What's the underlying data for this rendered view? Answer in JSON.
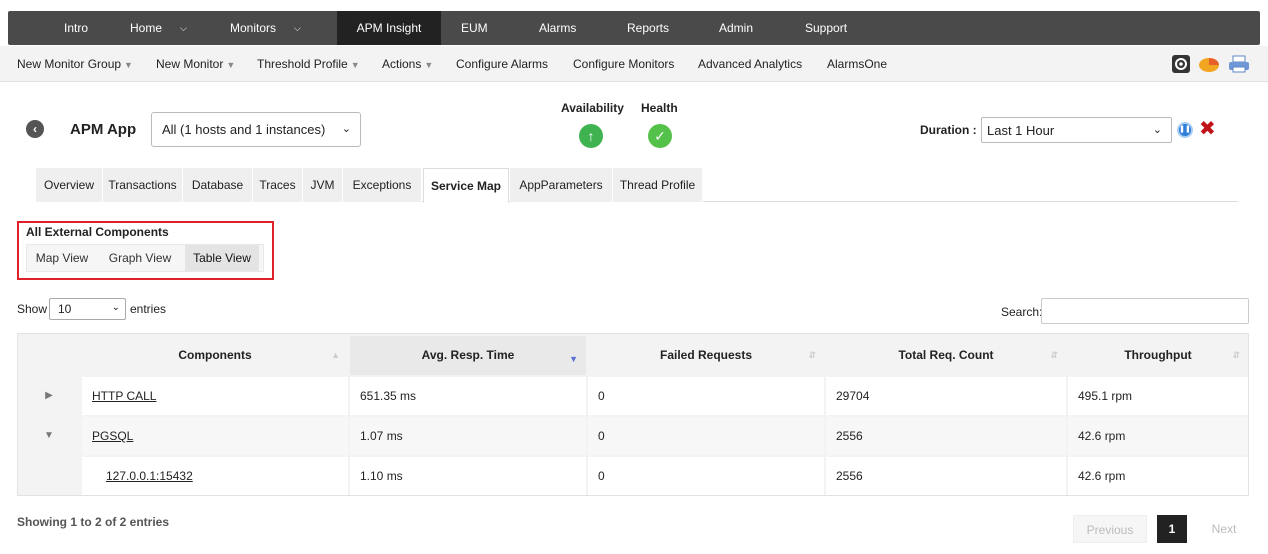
{
  "topnav": {
    "items": [
      {
        "label": "Intro",
        "caret": false
      },
      {
        "label": "Home",
        "caret": true
      },
      {
        "label": "Monitors",
        "caret": true
      },
      {
        "label": "APM Insight",
        "caret": false,
        "active": true
      },
      {
        "label": "EUM",
        "caret": false
      },
      {
        "label": "Alarms",
        "caret": false
      },
      {
        "label": "Reports",
        "caret": false
      },
      {
        "label": "Admin",
        "caret": false
      },
      {
        "label": "Support",
        "caret": false
      }
    ]
  },
  "subnav": {
    "new_monitor_group": "New Monitor Group",
    "new_monitor": "New Monitor",
    "threshold_profile": "Threshold Profile",
    "actions": "Actions",
    "configure_alarms": "Configure Alarms",
    "configure_monitors": "Configure Monitors",
    "advanced_analytics": "Advanced Analytics",
    "alarms_one": "AlarmsOne"
  },
  "header": {
    "app_title": "APM App",
    "host_select": "All (1 hosts and 1 instances)",
    "availability_label": "Availability",
    "health_label": "Health",
    "duration_label": "Duration :",
    "duration_value": "Last 1 Hour"
  },
  "tabs": [
    "Overview",
    "Transactions",
    "Database",
    "Traces",
    "JVM",
    "Exceptions",
    "Service Map",
    "AppParameters",
    "Thread Profile"
  ],
  "external": {
    "title": "All External Components",
    "views": [
      "Map View",
      "Graph View",
      "Table View"
    ]
  },
  "table_controls": {
    "show": "Show",
    "entries_value": "10",
    "entries": "entries",
    "search": "Search:"
  },
  "table": {
    "columns": [
      "Components",
      "Avg. Resp. Time",
      "Failed Requests",
      "Total Req. Count",
      "Throughput"
    ],
    "rows": [
      {
        "toggle": "▶",
        "component": "HTTP CALL",
        "avg": "651.35 ms",
        "failed": "0",
        "total": "29704",
        "throughput": "495.1 rpm"
      },
      {
        "toggle": "▼",
        "component": "PGSQL",
        "avg": "1.07 ms",
        "failed": "0",
        "total": "2556",
        "throughput": "42.6 rpm"
      },
      {
        "toggle": "",
        "component": "127.0.0.1:15432",
        "avg": "1.10 ms",
        "failed": "0",
        "total": "2556",
        "throughput": "42.6 rpm"
      }
    ]
  },
  "footer": {
    "info": "Showing 1 to 2 of 2 entries",
    "previous": "Previous",
    "page": "1",
    "next": "Next"
  },
  "colors": {
    "topnav_bg": "#4a4a4a",
    "availability_green": "#3fb34f",
    "health_green": "#54c24a",
    "highlight_red": "#e0202a",
    "close_red": "#c0141a"
  }
}
